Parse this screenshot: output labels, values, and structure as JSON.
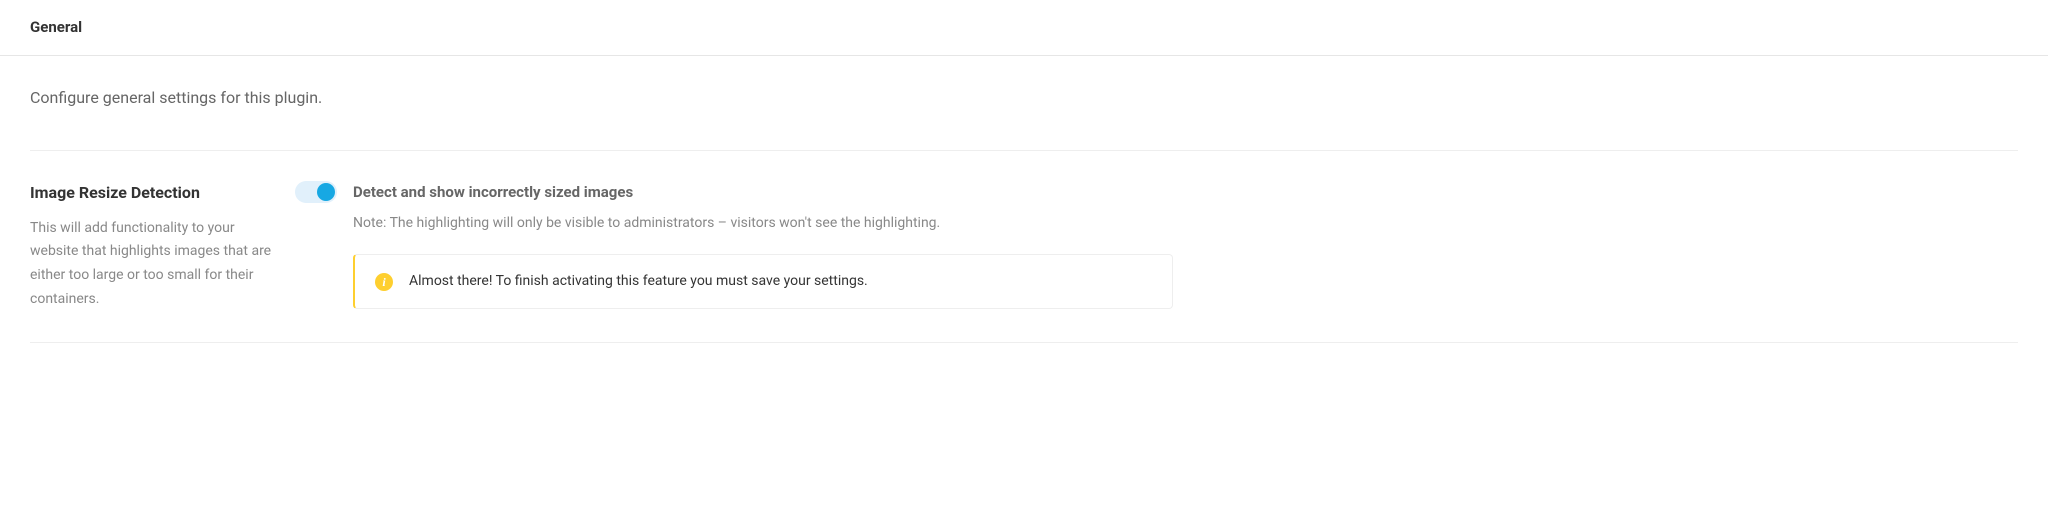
{
  "header": {
    "title": "General"
  },
  "intro": "Configure general settings for this plugin.",
  "setting": {
    "title": "Image Resize Detection",
    "description": "This will add functionality to your website that highlights images that are either too large or too small for their containers.",
    "toggle": {
      "on": true,
      "label": "Detect and show incorrectly sized images"
    },
    "note": "Note: The highlighting will only be visible to administrators – visitors won't see the highlighting.",
    "notice": {
      "icon": "i",
      "text": "Almost there! To finish activating this feature you must save your settings."
    }
  }
}
